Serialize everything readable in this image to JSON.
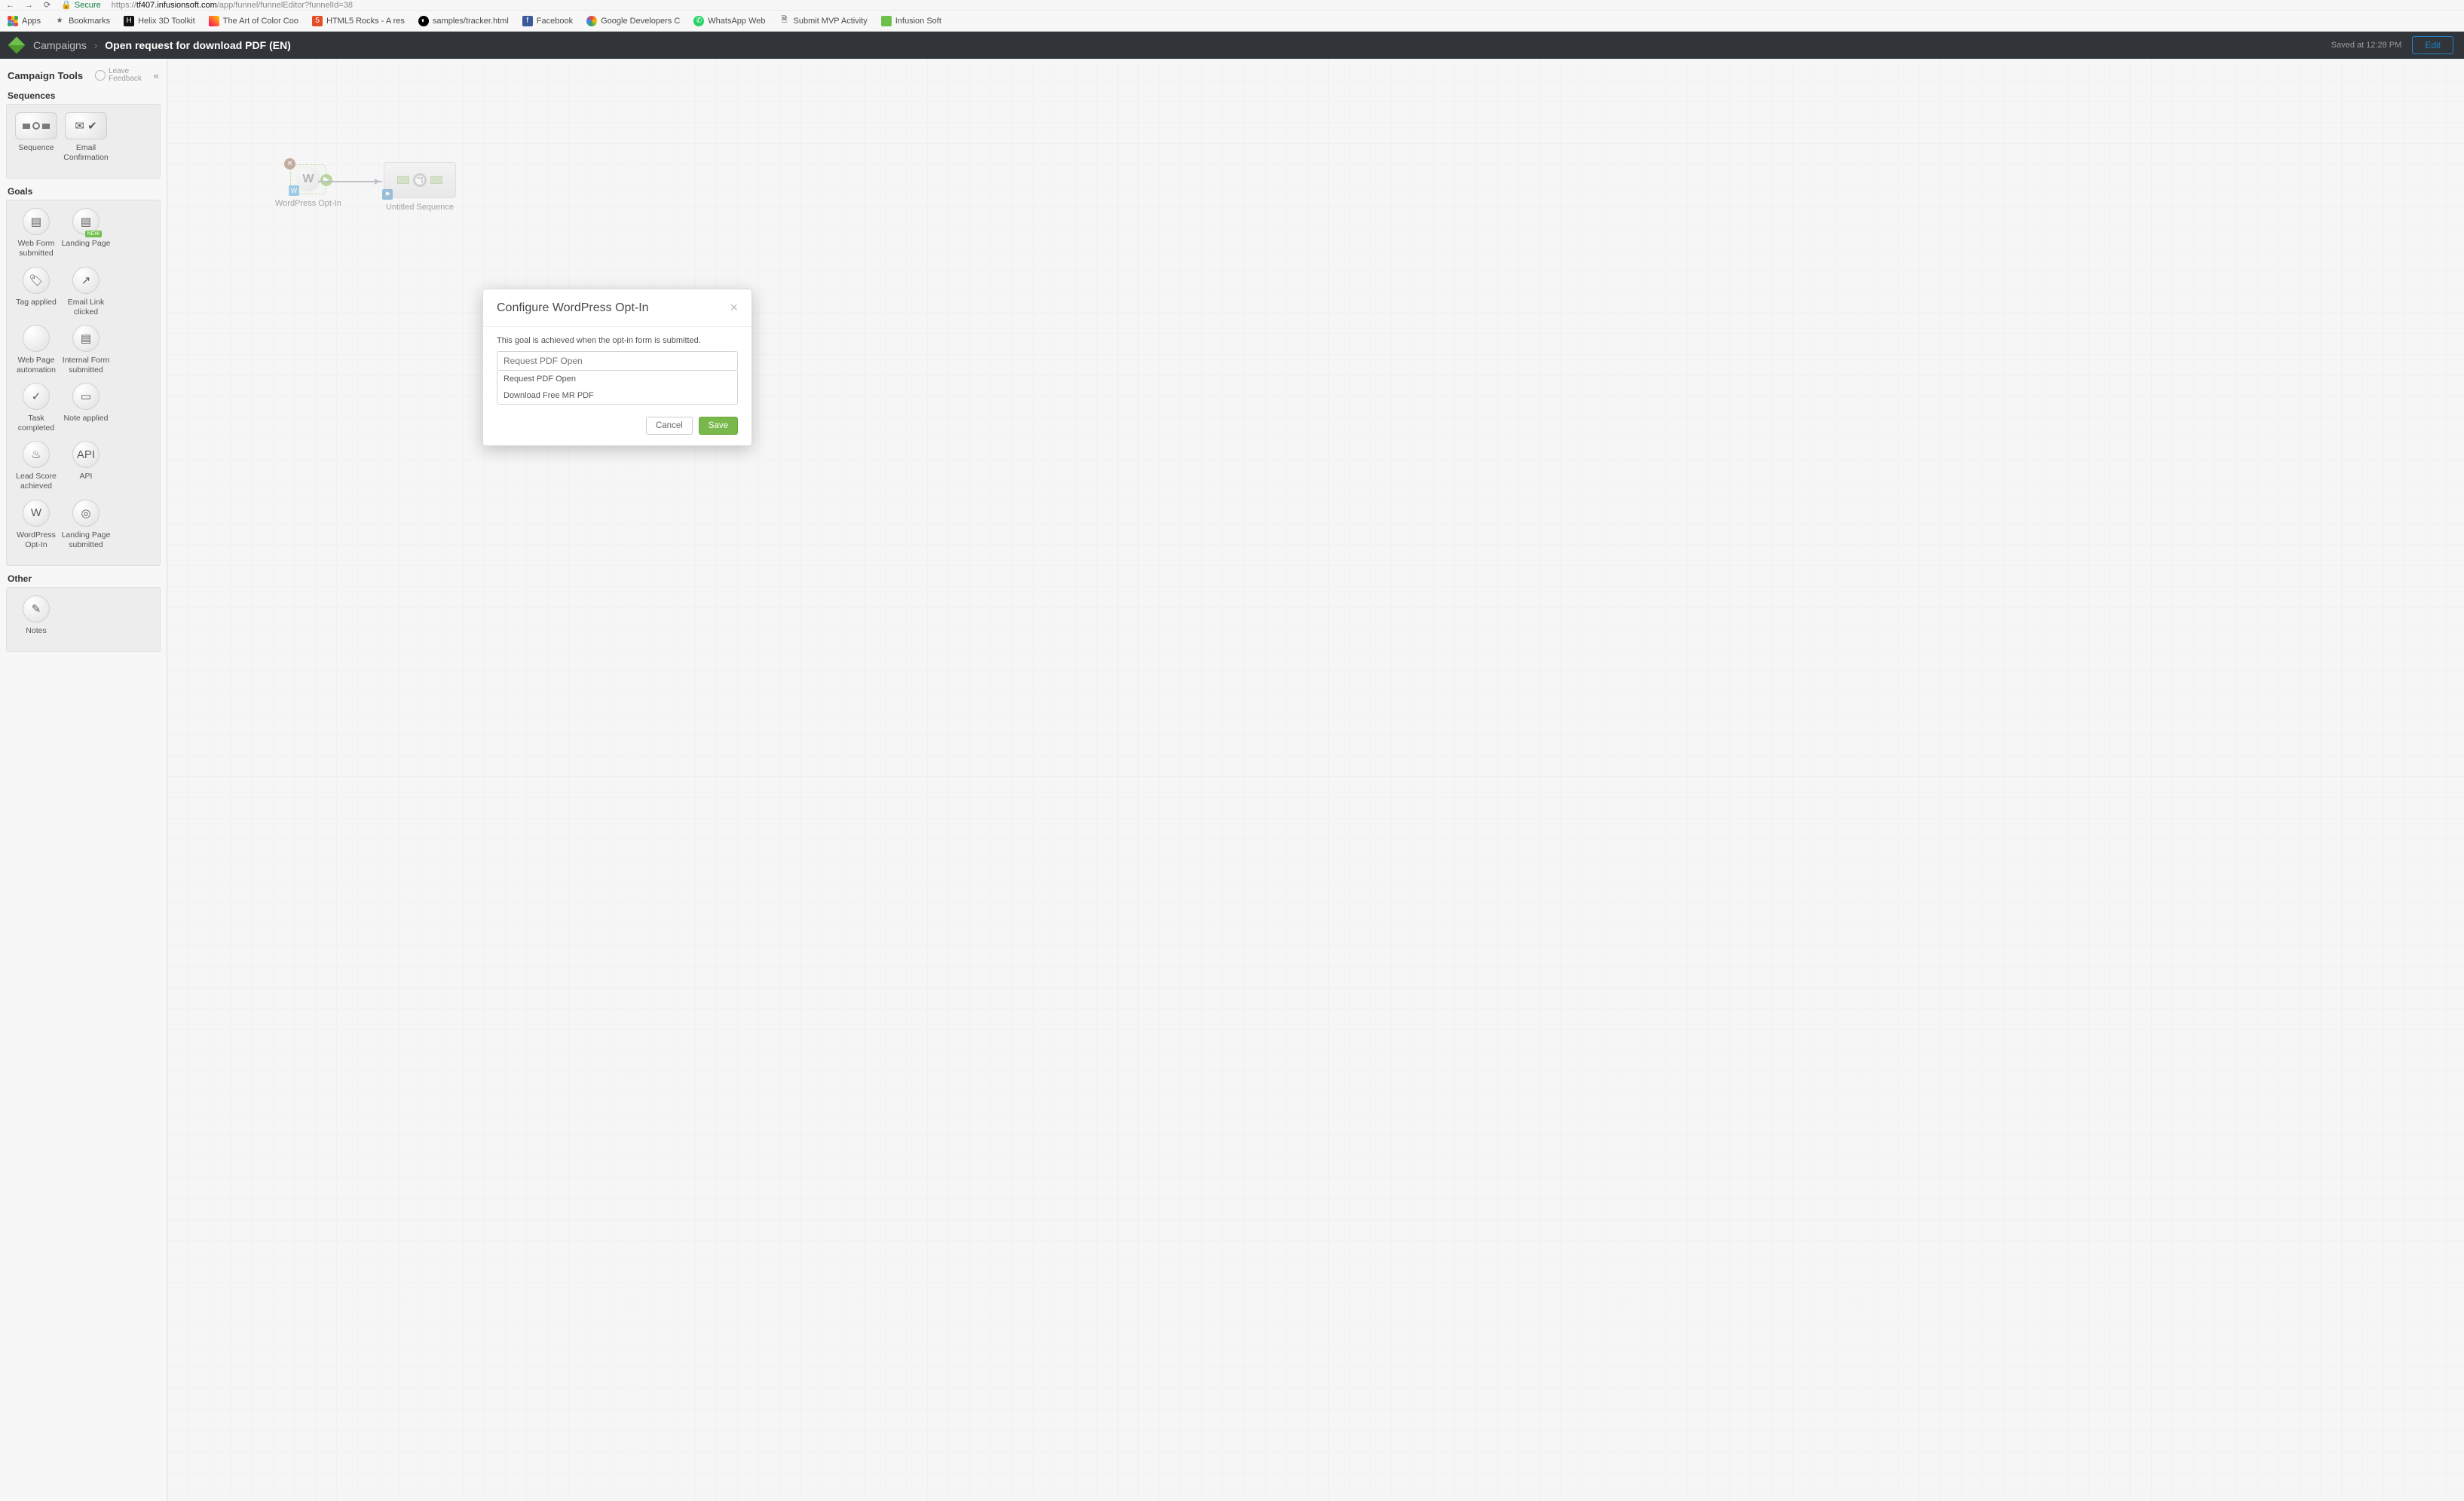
{
  "browser": {
    "secure_label": "Secure",
    "url_domain": "tf407.infusionsoft.com",
    "url_path": "/app/funnel/funnelEditor?funnelId=38",
    "url_prefix": "https://"
  },
  "bookmarks": [
    {
      "label": "Apps"
    },
    {
      "label": "Bookmarks"
    },
    {
      "label": "Helix 3D Toolkit"
    },
    {
      "label": "The Art of Color Coo"
    },
    {
      "label": "HTML5 Rocks - A res"
    },
    {
      "label": "samples/tracker.html"
    },
    {
      "label": "Facebook"
    },
    {
      "label": "Google Developers C"
    },
    {
      "label": "WhatsApp Web"
    },
    {
      "label": "Submit MVP Activity"
    },
    {
      "label": "Infusion Soft"
    }
  ],
  "header": {
    "crumb_root": "Campaigns",
    "crumb_current": "Open request for download PDF (EN)",
    "saved_text": "Saved at 12:28 PM",
    "edit_label": "Edit"
  },
  "sidebar": {
    "title": "Campaign Tools",
    "feedback_l1": "Leave",
    "feedback_l2": "Feedback",
    "section_sequences": "Sequences",
    "section_goals": "Goals",
    "section_other": "Other",
    "tools_seq": [
      {
        "label": "Sequence"
      },
      {
        "label": "Email Confirmation"
      }
    ],
    "tools_goals": [
      {
        "label": "Web Form submitted",
        "glyph": "▤"
      },
      {
        "label": "Landing Page",
        "glyph": "▤",
        "new": true
      },
      {
        "label": "Tag applied",
        "glyph": "🏷"
      },
      {
        "label": "Email Link clicked",
        "glyph": "↗"
      },
      {
        "label": "Web Page automation",
        "glyph": "</>"
      },
      {
        "label": "Internal Form submitted",
        "glyph": "▤"
      },
      {
        "label": "Task completed",
        "glyph": "✓"
      },
      {
        "label": "Note applied",
        "glyph": "▭"
      },
      {
        "label": "Lead Score achieved",
        "glyph": "♨"
      },
      {
        "label": "API",
        "glyph": "API"
      },
      {
        "label": "WordPress Opt-In",
        "glyph": "W"
      },
      {
        "label": "Landing Page submitted",
        "glyph": "◎"
      }
    ],
    "tools_other": [
      {
        "label": "Notes",
        "glyph": "✎"
      }
    ]
  },
  "canvas": {
    "goal_label": "WordPress Opt-In",
    "seq_label": "Untitled Sequence"
  },
  "modal": {
    "title": "Configure WordPress Opt-In",
    "desc": "This goal is achieved when the opt-in form is submitted.",
    "placeholder": "Request PDF Open",
    "options": [
      {
        "label": "Request PDF Open"
      },
      {
        "label": "Download Free MR PDF"
      }
    ],
    "cancel": "Cancel",
    "save": "Save"
  }
}
